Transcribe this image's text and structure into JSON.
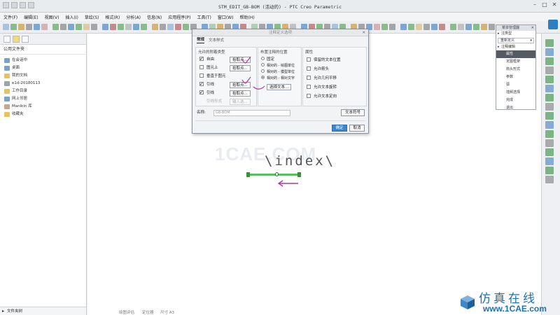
{
  "window": {
    "title": "STM_EDIT_GB-BOM (活动的) - PTC Creo Parametric",
    "minimize": "–",
    "maximize": "□",
    "close": "✕"
  },
  "menu": [
    "文件(F)",
    "编辑(E)",
    "视图(V)",
    "插入(I)",
    "草绘(S)",
    "格式(R)",
    "分析(A)",
    "信息(N)",
    "应用程序(P)",
    "工具(T)",
    "窗口(W)",
    "帮助(H)"
  ],
  "sidebar": {
    "header": "公用文件夹",
    "items": [
      "在会话中",
      "桌面",
      "我的文档",
      "e1d-20180113",
      "工作目录",
      "网上邻居",
      "Manikin 库",
      "收藏夹"
    ],
    "footer": "文件夹树"
  },
  "canvas": {
    "note_text": "\\index\\",
    "watermark": "1CAE.COM"
  },
  "status": {
    "a": "绘图评估",
    "b": "定位器",
    "c": "尺寸 A3"
  },
  "menu_manager": {
    "title": "菜单管理器",
    "section1": "注类型",
    "dropdown": "重新定义",
    "section2": "注释编辑",
    "items": [
      "属性",
      "定图框架",
      "箭头形式",
      "参数",
      "弧",
      "插频选择",
      "完成",
      "退出"
    ]
  },
  "dialog": {
    "title": "注释定义选项",
    "tabs": [
      "常规",
      "文本样式"
    ],
    "leader_group": {
      "label": "允许的附着类型",
      "rows": [
        "自由",
        "图元上",
        "垂直于图元",
        "引线",
        "引线"
      ],
      "button": "拾取点...",
      "last": "引线形式",
      "last_button": "输入选..."
    },
    "placement_group": {
      "label": "布置注释的位置",
      "options": [
        "固定",
        "相对的 - 绘图单位",
        "相对的 - 模型单位",
        "相对的 - 相对文字"
      ],
      "button": "选择文本..."
    },
    "props_group": {
      "label": "属性",
      "items": [
        "保留的文本位置",
        "允许箭头",
        "允许几何平移",
        "允许文本旋转",
        "允许文本定向"
      ]
    },
    "name_label": "名称:",
    "name_value": "GB-BOM",
    "symbol_button": "文本符号",
    "ok": "确定",
    "cancel": "取消"
  },
  "logo": {
    "top": "仿真在线",
    "bottom": "www.1CAE.com"
  },
  "colors": {
    "accent": "#3d85c6",
    "leader": "#58c05a",
    "annotation": "#b5379b",
    "logo": "#1d6fb8"
  }
}
